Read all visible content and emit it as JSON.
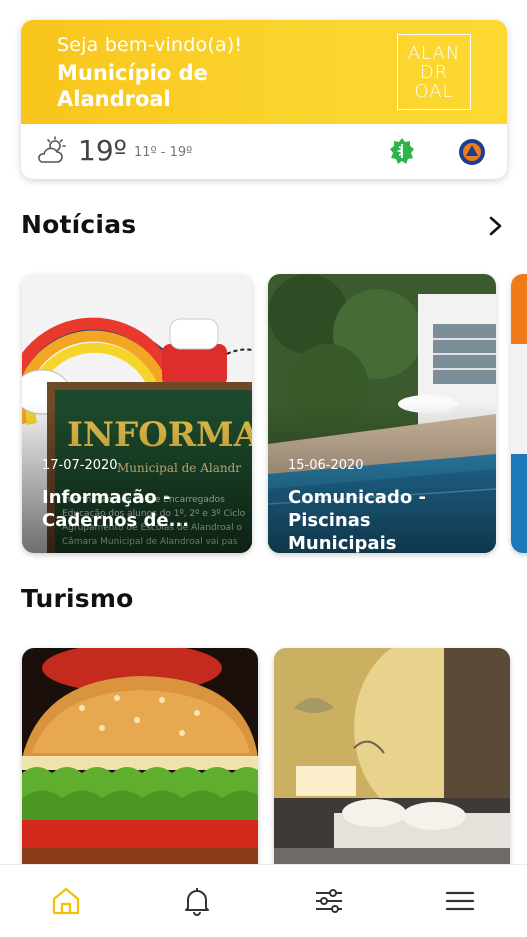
{
  "header": {
    "welcome": "Seja bem-vindo(a)!",
    "municipality": "Município de Alandroal",
    "logo_lines": [
      "ALAN",
      "DR",
      "OAL"
    ],
    "temperature": "19º",
    "temp_range": "11º - 19º",
    "weather_icon": "partly-cloudy-icon"
  },
  "sections": {
    "news": "Notícias",
    "tourism": "Turismo"
  },
  "news": [
    {
      "date": "17-07-2020",
      "title": "Informação - Cadernos de..."
    },
    {
      "date": "15-06-2020",
      "title": "Comunicado - Piscinas Municipais"
    }
  ],
  "tourism": [
    {
      "image": "burger-image"
    },
    {
      "image": "hotel-room-image"
    }
  ],
  "nav": [
    "home-icon",
    "bell-icon",
    "filters-icon",
    "menu-icon"
  ],
  "colors": {
    "brand_yellow": "#f9c81f",
    "active_nav": "#f2c200",
    "health_green": "#2db34a",
    "civil_blue": "#1c3f8f",
    "civil_orange": "#f07b1a"
  }
}
